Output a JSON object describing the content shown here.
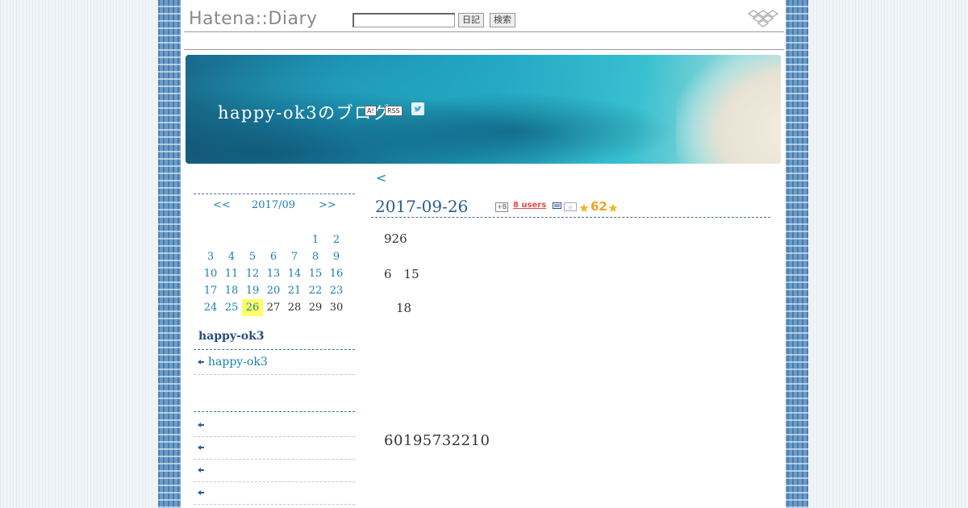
{
  "header": {
    "logo": "Hatena::Diary",
    "search_placeholder": "",
    "diary_button": "日記",
    "search_button": "検索"
  },
  "banner": {
    "title": "happy-ok3のブログ",
    "icons": [
      "antenna-icon",
      "rss-icon",
      "twitter-icon"
    ],
    "antenna_label": "A!",
    "rss_label": "RSS"
  },
  "calendar": {
    "prev": "<<",
    "month": "2017/09",
    "next": ">>",
    "weeks": [
      [
        "",
        "",
        "",
        "",
        "",
        "1",
        "2"
      ],
      [
        "3",
        "4",
        "5",
        "6",
        "7",
        "8",
        "9"
      ],
      [
        "10",
        "11",
        "12",
        "13",
        "14",
        "15",
        "16"
      ],
      [
        "17",
        "18",
        "19",
        "20",
        "21",
        "22",
        "23"
      ],
      [
        "24",
        "25",
        "26",
        "27",
        "28",
        "29",
        "30"
      ]
    ],
    "today": "26"
  },
  "sidebar": {
    "heading": "happy-ok3",
    "profile_link": "happy-ok3",
    "recent_items": [
      "",
      "",
      "",
      ""
    ]
  },
  "main": {
    "prev_link": "<",
    "date": "2017-09-26",
    "bookmark_icon_label": "+B",
    "users": "8 users",
    "star_count": "62",
    "lines": [
      "926",
      "6　15",
      "　18"
    ],
    "big_number": "60195732210"
  },
  "colors": {
    "link": "#1a7fb0",
    "heading": "#2a5d8f",
    "today_highlight": "#ffff66",
    "star": "#f0a21c",
    "users": "#e84a4a"
  }
}
